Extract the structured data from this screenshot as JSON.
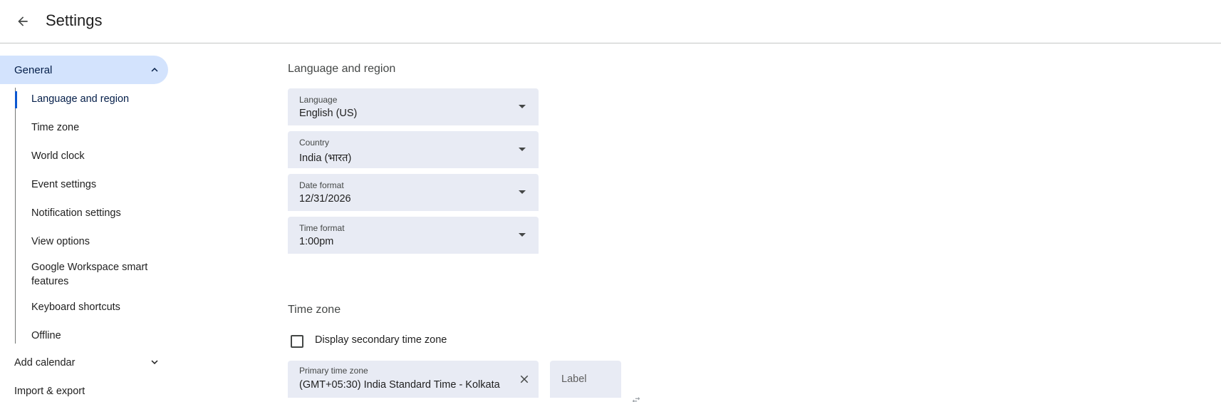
{
  "header": {
    "title": "Settings",
    "back_icon": "arrow-back-icon"
  },
  "sidebar": {
    "general": {
      "label": "General",
      "icon": "chevron-up-icon"
    },
    "sub_items": [
      {
        "label": "Language and region",
        "active": true
      },
      {
        "label": "Time zone"
      },
      {
        "label": "World clock"
      },
      {
        "label": "Event settings"
      },
      {
        "label": "Notification settings"
      },
      {
        "label": "View options"
      },
      {
        "label": "Google Workspace smart features"
      },
      {
        "label": "Keyboard shortcuts"
      },
      {
        "label": "Offline"
      }
    ],
    "add_calendar": {
      "label": "Add calendar",
      "icon": "chevron-down-icon"
    },
    "import_export": {
      "label": "Import & export"
    }
  },
  "language_region": {
    "title": "Language and region",
    "fields": [
      {
        "label": "Language",
        "value": "English (US)"
      },
      {
        "label": "Country",
        "value": "India (भारत)"
      },
      {
        "label": "Date format",
        "value": "12/31/2026"
      },
      {
        "label": "Time format",
        "value": "1:00pm"
      }
    ]
  },
  "time_zone": {
    "title": "Time zone",
    "secondary_checkbox_label": "Display secondary time zone",
    "secondary_checked": false,
    "primary": {
      "label": "Primary time zone",
      "value": "(GMT+05:30) India Standard Time - Kolkata",
      "clear_icon": "close-icon"
    },
    "label_placeholder": "Label"
  },
  "colors": {
    "accent": "#0b57d0",
    "selected_bg": "#d3e3fd",
    "field_bg": "#e8ebf4"
  }
}
